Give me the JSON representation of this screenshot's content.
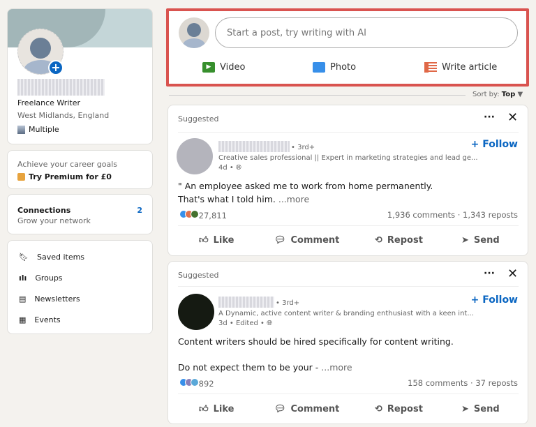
{
  "profile": {
    "title": "Freelance Writer",
    "location": "West Midlands, England",
    "org": "Multiple"
  },
  "premium": {
    "prompt": "Achieve your career goals",
    "cta": "Try Premium for £0"
  },
  "connections": {
    "label": "Connections",
    "sub": "Grow your network",
    "count": "2"
  },
  "nav": [
    {
      "label": "Saved items",
      "icon": "bookmark-icon"
    },
    {
      "label": "Groups",
      "icon": "groups-icon"
    },
    {
      "label": "Newsletters",
      "icon": "newsletter-icon"
    },
    {
      "label": "Events",
      "icon": "calendar-icon"
    }
  ],
  "share": {
    "placeholder": "Start a post, try writing with AI",
    "video": "Video",
    "photo": "Photo",
    "article": "Write article",
    "highlight_color": "#d9534f"
  },
  "sort": {
    "label": "Sort by:",
    "value": "Top"
  },
  "actions": {
    "like": "Like",
    "comment": "Comment",
    "repost": "Repost",
    "send": "Send",
    "follow": "+ Follow"
  },
  "posts": [
    {
      "tag": "Suggested",
      "degree": "• 3rd+",
      "headline": "Creative sales professional || Expert in marketing strategies and lead ge...",
      "meta": "4d •",
      "line1": "\" An employee asked me to work from home permanently.",
      "line2": "That's what I told him.",
      "more": "...more",
      "reactions": "27,811",
      "stats": "1,936 comments · 1,343 reposts"
    },
    {
      "tag": "Suggested",
      "degree": "• 3rd+",
      "headline": "A Dynamic, active content writer & branding enthusiast with a keen int...",
      "meta": "3d • Edited •",
      "line1": "Content writers should be hired specifically for content writing.",
      "line2": "Do not expect them to be your -",
      "more": "...more",
      "reactions": "892",
      "stats": "158 comments · 37 reposts"
    }
  ]
}
